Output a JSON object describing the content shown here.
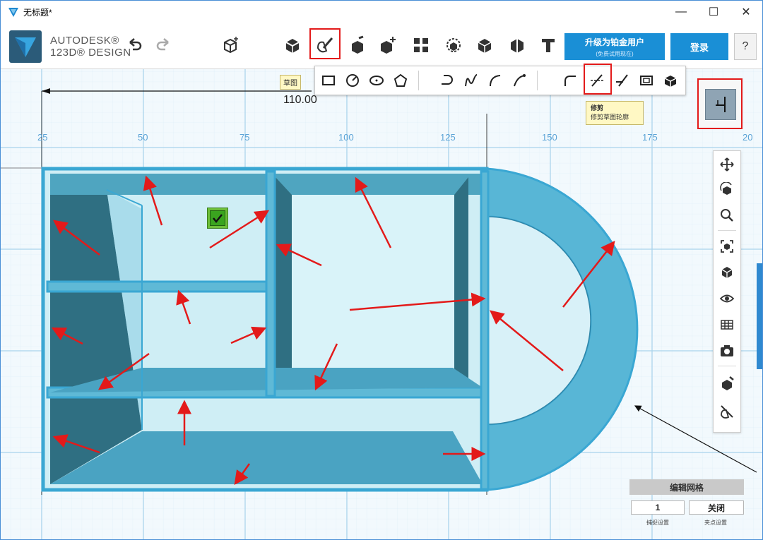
{
  "window": {
    "title": "无标题*",
    "controls": [
      "minimize-icon",
      "maximize-icon",
      "close-icon"
    ]
  },
  "brand": {
    "line1": "AUTODESK®",
    "line2": "123D® DESIGN"
  },
  "toolbar": {
    "icons": [
      "undo-icon",
      "redo-icon",
      "new-primitive-icon",
      "primitives-icon",
      "sketch-icon",
      "construct-icon",
      "modify-icon",
      "pattern-icon",
      "grouping-icon",
      "combine-icon",
      "measure-icon",
      "text-icon"
    ],
    "upgrade_label": "升级为铂金用户",
    "upgrade_sublabel": "(免费试用现在)",
    "login_label": "登录",
    "help_label": "?"
  },
  "sketch_menu": {
    "tooltip": "草图",
    "tools": [
      "sketch-rectangle-icon",
      "sketch-circle-icon",
      "sketch-ellipse-icon",
      "sketch-polygon-icon",
      "sketch-polyline-icon",
      "sketch-spline-icon",
      "sketch-two-point-arc-icon",
      "sketch-three-point-arc-icon",
      "sketch-fillet-icon",
      "sketch-trim-icon",
      "sketch-extend-icon",
      "sketch-offset-icon",
      "project-icon"
    ]
  },
  "trim_tooltip": {
    "title": "修剪",
    "description": "修剪草图轮廓"
  },
  "dimension_value": "110.00",
  "ruler": {
    "labels": [
      "25",
      "50",
      "75",
      "100",
      "125",
      "150",
      "175",
      "20"
    ]
  },
  "right_nav": {
    "icons": [
      "pan-icon",
      "orbit-icon",
      "zoom-icon",
      "fit-icon",
      "view-cube-icon",
      "visibility-icon",
      "material-icon",
      "camera-icon",
      "snap-icon",
      "hide-sketch-icon"
    ]
  },
  "grid_panel": {
    "header": "编辑网格",
    "snap_value": "1",
    "grid_toggle": "关闭",
    "snap_caption": "捕捉设置",
    "grid_caption": "夹点设置"
  },
  "colors": {
    "accent": "#1a8fd6",
    "model_blue": "#4fb3d6",
    "grid_line": "#bfe0f2",
    "highlight_red": "#e31a1a"
  }
}
